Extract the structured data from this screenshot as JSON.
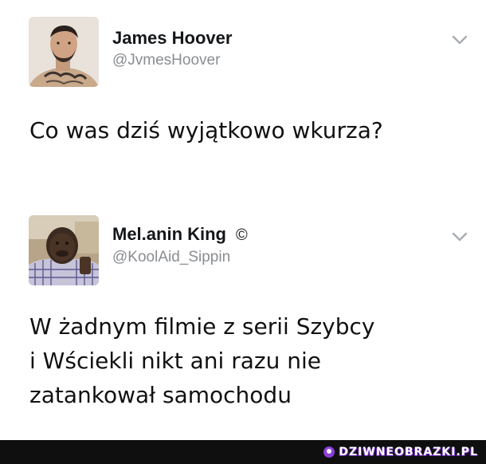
{
  "tweets": [
    {
      "display_name": "James Hoover",
      "handle": "@JvmesHoover",
      "text": "Co was dziś wyjątkowo wkurza?",
      "avatar_icon": "profile-photo-man-tattoos",
      "menu_icon": "chevron-down-icon"
    },
    {
      "display_name": "Mel.anin King",
      "verified_symbol": "©",
      "handle": "@KoolAid_Sippin",
      "text": "W żadnym filmie z serii Szybcy\ni Wściekli nikt ani razu nie\nzatankował samochodu",
      "avatar_icon": "profile-photo-man-plaid-shirt",
      "menu_icon": "chevron-down-icon"
    }
  ],
  "footer": {
    "watermark": "DZIWNEOBRAZKI.PL",
    "background_color": "#0f0f10",
    "accent_color": "#8b3fd9"
  }
}
